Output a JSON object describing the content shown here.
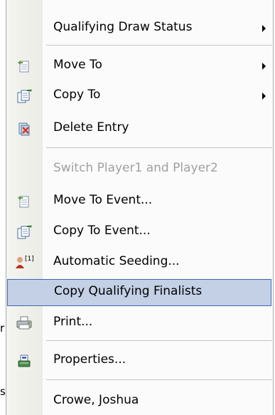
{
  "background_text": {
    "top": "...",
    "left_1": "r",
    "left_2": "s"
  },
  "menu": {
    "items": [
      {
        "label": "Qualifying Draw Status",
        "icon": null,
        "submenu": true
      },
      {
        "label": "Move To",
        "icon": "move-document-icon",
        "submenu": true
      },
      {
        "label": "Copy To",
        "icon": "copy-document-icon",
        "submenu": true
      },
      {
        "label": "Delete Entry",
        "icon": "delete-entry-icon",
        "submenu": false
      },
      {
        "label": "Switch Player1 and Player2",
        "icon": null,
        "submenu": false,
        "disabled": true
      },
      {
        "label": "Move To Event...",
        "icon": "move-document-icon",
        "submenu": false
      },
      {
        "label": "Copy To Event...",
        "icon": "copy-document-icon",
        "submenu": false
      },
      {
        "label": "Automatic Seeding...",
        "icon": "seeding-icon",
        "submenu": false
      },
      {
        "label": "Copy Qualifying Finalists",
        "icon": null,
        "submenu": false,
        "highlighted": true
      },
      {
        "label": "Print...",
        "icon": "printer-icon",
        "submenu": false
      },
      {
        "label": "Properties...",
        "icon": "properties-icon",
        "submenu": false
      },
      {
        "label": "Crowe, Joshua",
        "icon": null,
        "submenu": false
      }
    ],
    "seeding_icon_text": "[1]"
  },
  "colors": {
    "highlight_fill": "#c3d0e6",
    "highlight_border": "#3e68b1",
    "disabled_text": "#a0a0a0"
  }
}
